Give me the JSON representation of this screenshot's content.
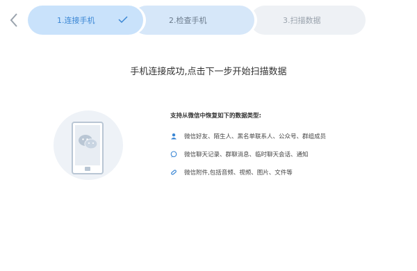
{
  "nav": {
    "back_icon": "chevron-left-icon"
  },
  "steps": [
    {
      "label": "1.连接手机",
      "state": "done"
    },
    {
      "label": "2.检查手机",
      "state": "current"
    },
    {
      "label": "3.扫描数据",
      "state": "pending"
    }
  ],
  "main": {
    "headline": "手机连接成功,点击下一步开始扫描数据",
    "supports_title": "支持从微信中恢复如下的数据类型:",
    "features": [
      {
        "icon": "contact-icon",
        "text": "微信好友、陌生人、黑名单联系人、公众号、群组成员"
      },
      {
        "icon": "chat-bubble-icon",
        "text": "微信聊天记录、群聊消息、临时聊天会话、通知"
      },
      {
        "icon": "attachment-icon",
        "text": "微信附件,包括音频、视频、图片、文件等"
      }
    ]
  },
  "colors": {
    "accent": "#3a86d4",
    "step_done_bg": "#c9e2fb",
    "step_current_bg": "#d6e7f9",
    "step_pending_bg": "#eef1f5"
  }
}
